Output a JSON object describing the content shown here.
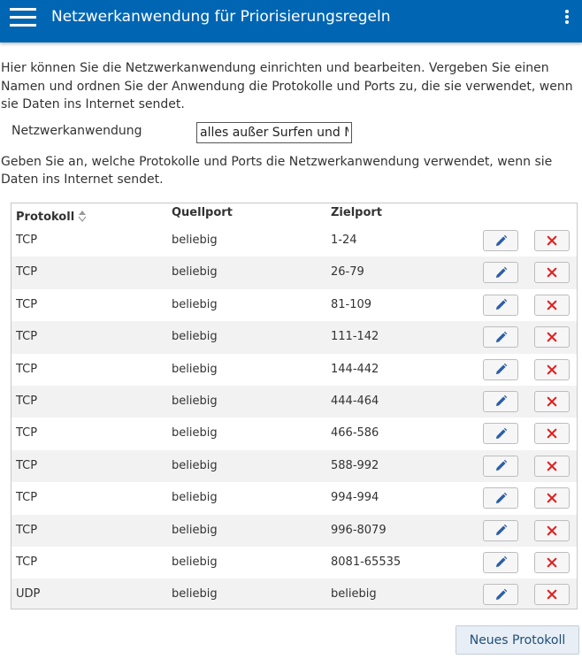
{
  "header": {
    "title": "Netzwerkanwendung für Priorisierungsregeln",
    "menu_icon": "hamburger-menu-icon",
    "more_icon": "more-vertical-icon",
    "background_color": "#0066b3"
  },
  "intro_text": "Hier können Sie die Netzwerkanwendung einrichten und bearbeiten. Vergeben Sie einen Namen und ordnen Sie der Anwendung die Protokolle und Ports zu, die sie verwendet, wenn sie Daten ins Internet sendet.",
  "application_field": {
    "label": "Netzwerkanwendung",
    "value": "alles außer Surfen und Ma"
  },
  "table_description": "Geben Sie an, welche Protokolle und Ports die Netzwerkanwendung verwendet, wenn sie Daten ins Internet sendet.",
  "table": {
    "columns": [
      "Protokoll",
      "Quellport",
      "Zielport"
    ],
    "sort_icon": "sort-icon",
    "edit_icon": "pencil-icon",
    "delete_icon": "close-icon",
    "edit_color": "#2b5ea7",
    "delete_color": "#e02020",
    "rows": [
      {
        "protocol": "TCP",
        "source_port": "beliebig",
        "dest_port": "1-24"
      },
      {
        "protocol": "TCP",
        "source_port": "beliebig",
        "dest_port": "26-79"
      },
      {
        "protocol": "TCP",
        "source_port": "beliebig",
        "dest_port": "81-109"
      },
      {
        "protocol": "TCP",
        "source_port": "beliebig",
        "dest_port": "111-142"
      },
      {
        "protocol": "TCP",
        "source_port": "beliebig",
        "dest_port": "144-442"
      },
      {
        "protocol": "TCP",
        "source_port": "beliebig",
        "dest_port": "444-464"
      },
      {
        "protocol": "TCP",
        "source_port": "beliebig",
        "dest_port": "466-586"
      },
      {
        "protocol": "TCP",
        "source_port": "beliebig",
        "dest_port": "588-992"
      },
      {
        "protocol": "TCP",
        "source_port": "beliebig",
        "dest_port": "994-994"
      },
      {
        "protocol": "TCP",
        "source_port": "beliebig",
        "dest_port": "996-8079"
      },
      {
        "protocol": "TCP",
        "source_port": "beliebig",
        "dest_port": "8081-65535"
      },
      {
        "protocol": "UDP",
        "source_port": "beliebig",
        "dest_port": "beliebig"
      }
    ]
  },
  "new_protocol_button": "Neues Protokoll"
}
